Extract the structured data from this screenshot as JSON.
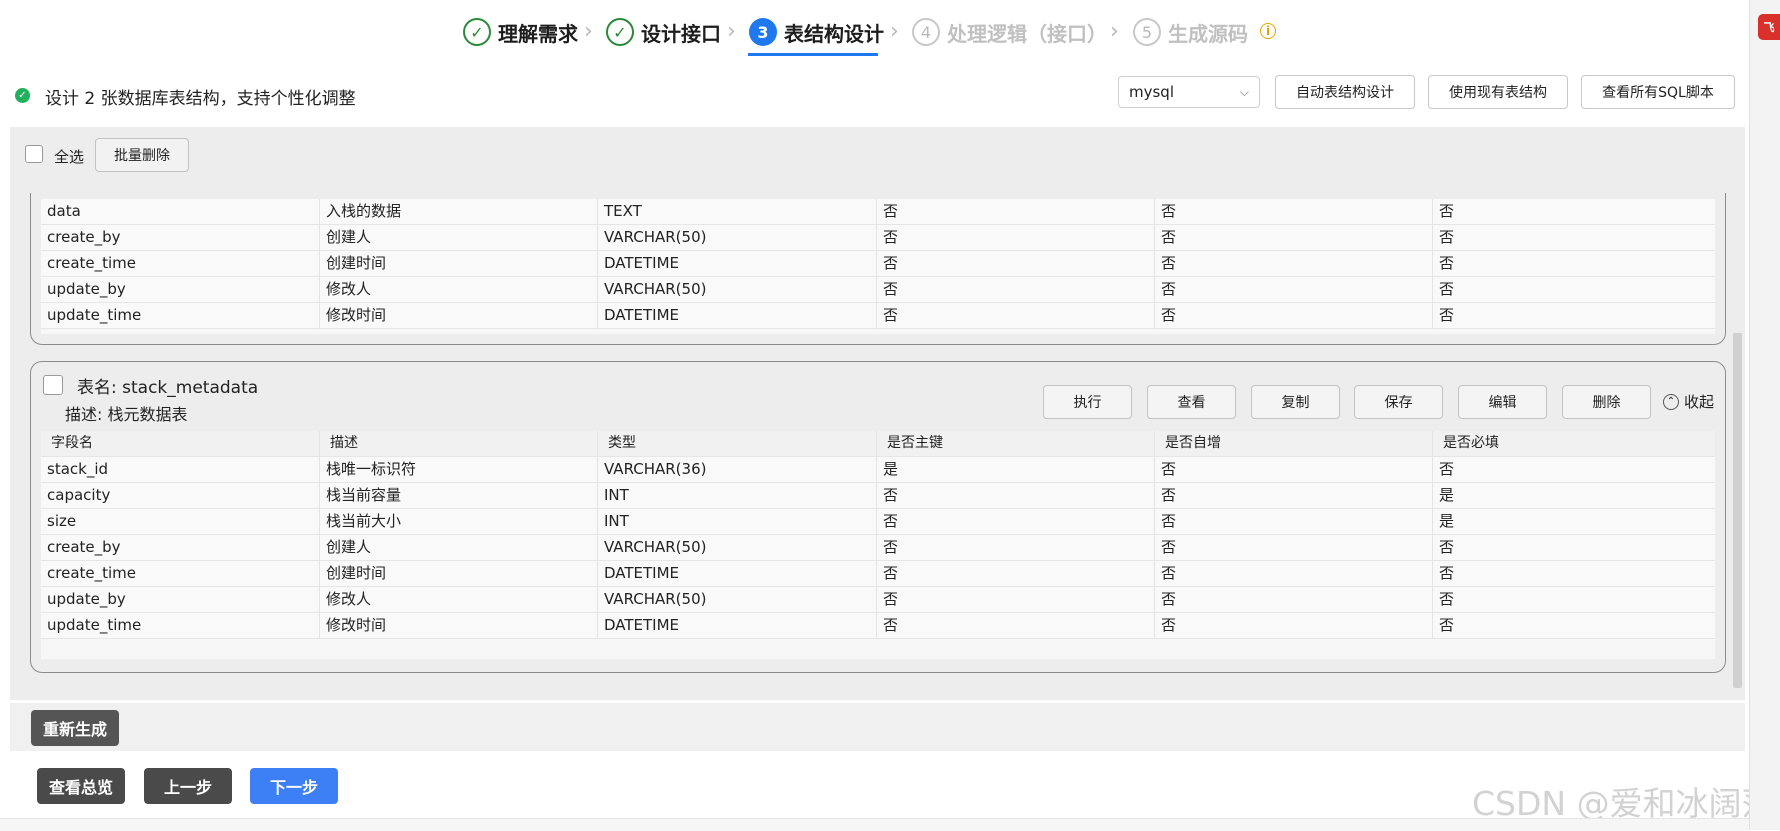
{
  "stepper": {
    "steps": [
      {
        "num": "✓",
        "label": "理解需求",
        "state": "done"
      },
      {
        "num": "✓",
        "label": "设计接口",
        "state": "done"
      },
      {
        "num": "3",
        "label": "表结构设计",
        "state": "active"
      },
      {
        "num": "4",
        "label": "处理逻辑（接口）",
        "state": "todo"
      },
      {
        "num": "5",
        "label": "生成源码",
        "state": "todo"
      }
    ],
    "info": "i"
  },
  "toolbar": {
    "status": "设计 2 张数据库表结构，支持个性化调整",
    "db_select": "mysql",
    "auto_design": "自动表结构设计",
    "use_existing": "使用现有表结构",
    "view_sql": "查看所有SQL脚本"
  },
  "batch": {
    "select_all": "全选",
    "bulk_delete": "批量删除"
  },
  "columns": [
    "字段名",
    "描述",
    "类型",
    "是否主键",
    "是否自增",
    "是否必填"
  ],
  "table1": {
    "rows": [
      [
        "data",
        "入栈的数据",
        "TEXT",
        "否",
        "否",
        "否"
      ],
      [
        "create_by",
        "创建人",
        "VARCHAR(50)",
        "否",
        "否",
        "否"
      ],
      [
        "create_time",
        "创建时间",
        "DATETIME",
        "否",
        "否",
        "否"
      ],
      [
        "update_by",
        "修改人",
        "VARCHAR(50)",
        "否",
        "否",
        "否"
      ],
      [
        "update_time",
        "修改时间",
        "DATETIME",
        "否",
        "否",
        "否"
      ]
    ]
  },
  "table2": {
    "title": "表名: stack_metadata",
    "desc": "描述: 栈元数据表",
    "actions": [
      "执行",
      "查看",
      "复制",
      "保存",
      "编辑",
      "删除"
    ],
    "collapse": "收起",
    "rows": [
      [
        "stack_id",
        "栈唯一标识符",
        "VARCHAR(36)",
        "是",
        "否",
        "否"
      ],
      [
        "capacity",
        "栈当前容量",
        "INT",
        "否",
        "否",
        "是"
      ],
      [
        "size",
        "栈当前大小",
        "INT",
        "否",
        "否",
        "是"
      ],
      [
        "create_by",
        "创建人",
        "VARCHAR(50)",
        "否",
        "否",
        "否"
      ],
      [
        "create_time",
        "创建时间",
        "DATETIME",
        "否",
        "否",
        "否"
      ],
      [
        "update_by",
        "修改人",
        "VARCHAR(50)",
        "否",
        "否",
        "否"
      ],
      [
        "update_time",
        "修改时间",
        "DATETIME",
        "否",
        "否",
        "否"
      ]
    ]
  },
  "footer": {
    "regenerate": "重新生成",
    "overview": "查看总览",
    "prev": "上一步",
    "next": "下一步"
  },
  "watermark": "CSDN @爱和冰阔落",
  "side_badge": "飞",
  "colors": {
    "primary": "#1e78f0",
    "success": "#22b15b",
    "dark_button": "#4a4a4a",
    "warning": "#e2a400"
  }
}
